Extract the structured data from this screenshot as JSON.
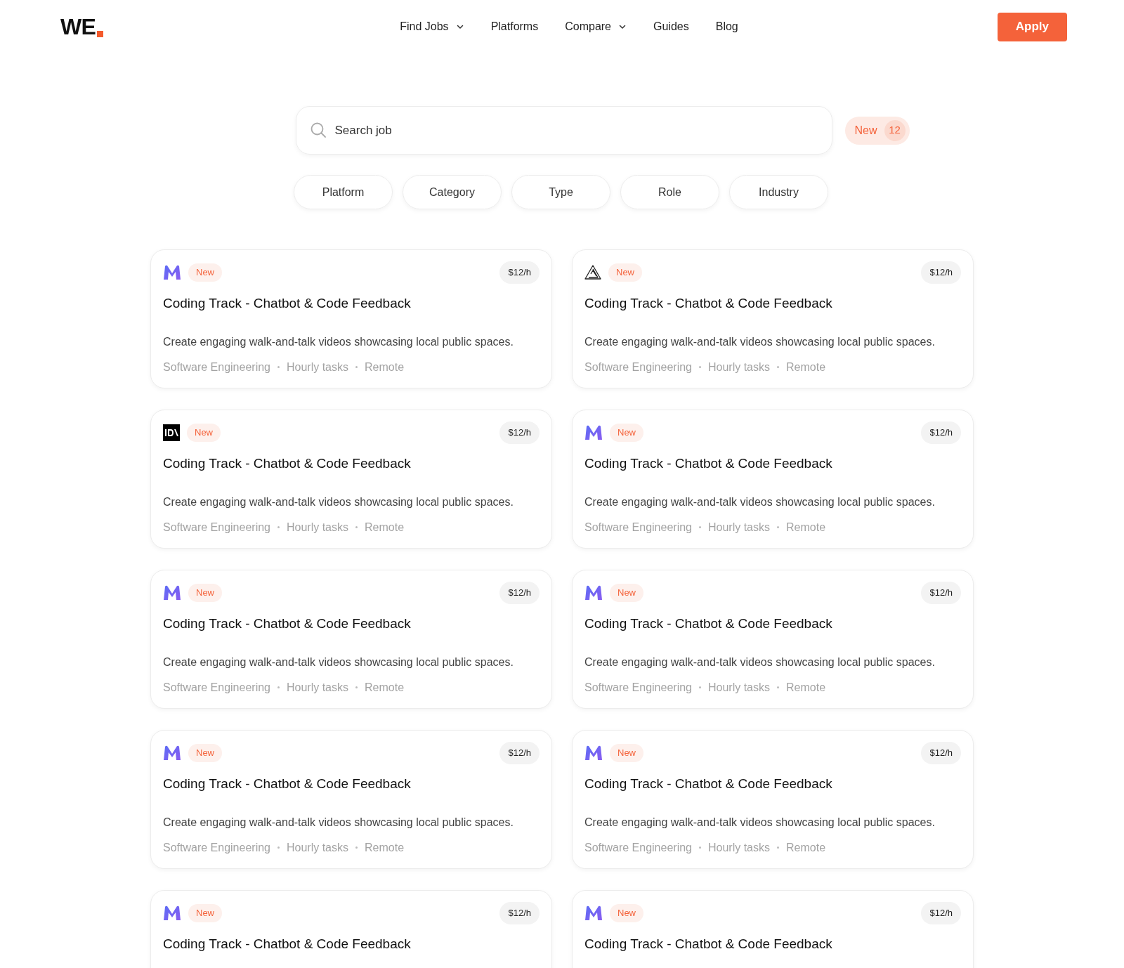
{
  "header": {
    "logo": "WE",
    "nav": [
      {
        "label": "Find Jobs",
        "dropdown": true
      },
      {
        "label": "Platforms",
        "dropdown": false
      },
      {
        "label": "Compare",
        "dropdown": true
      },
      {
        "label": "Guides",
        "dropdown": false
      },
      {
        "label": "Blog",
        "dropdown": false
      }
    ],
    "cta": "Apply"
  },
  "search": {
    "placeholder": "Search job",
    "new_label": "New",
    "new_count": "12"
  },
  "filters": [
    "Platform",
    "Category",
    "Type",
    "Role",
    "Industry"
  ],
  "jobs": [
    {
      "kind": "m",
      "badge": "New",
      "rate": "$12/h",
      "title": "Coding Track - Chatbot & Code Feedback",
      "description": "Create engaging walk-and-talk videos showcasing local public spaces.",
      "tags": [
        "Software Engineering",
        "Hourly tasks",
        "Remote"
      ]
    },
    {
      "kind": "triangle",
      "badge": "New",
      "rate": "$12/h",
      "title": "Coding Track - Chatbot & Code Feedback",
      "description": "Create engaging walk-and-talk videos showcasing local public spaces.",
      "tags": [
        "Software Engineering",
        "Hourly tasks",
        "Remote"
      ]
    },
    {
      "kind": "dv",
      "badge": "New",
      "rate": "$12/h",
      "title": "Coding Track - Chatbot & Code Feedback",
      "description": "Create engaging walk-and-talk videos showcasing local public spaces.",
      "tags": [
        "Software Engineering",
        "Hourly tasks",
        "Remote"
      ]
    },
    {
      "kind": "m",
      "badge": "New",
      "rate": "$12/h",
      "title": "Coding Track - Chatbot & Code Feedback",
      "description": "Create engaging walk-and-talk videos showcasing local public spaces.",
      "tags": [
        "Software Engineering",
        "Hourly tasks",
        "Remote"
      ]
    },
    {
      "kind": "m",
      "badge": "New",
      "rate": "$12/h",
      "title": "Coding Track - Chatbot & Code Feedback",
      "description": "Create engaging walk-and-talk videos showcasing local public spaces.",
      "tags": [
        "Software Engineering",
        "Hourly tasks",
        "Remote"
      ]
    },
    {
      "kind": "m",
      "badge": "New",
      "rate": "$12/h",
      "title": "Coding Track - Chatbot & Code Feedback",
      "description": "Create engaging walk-and-talk videos showcasing local public spaces.",
      "tags": [
        "Software Engineering",
        "Hourly tasks",
        "Remote"
      ]
    },
    {
      "kind": "m",
      "badge": "New",
      "rate": "$12/h",
      "title": "Coding Track - Chatbot & Code Feedback",
      "description": "Create engaging walk-and-talk videos showcasing local public spaces.",
      "tags": [
        "Software Engineering",
        "Hourly tasks",
        "Remote"
      ]
    },
    {
      "kind": "m",
      "badge": "New",
      "rate": "$12/h",
      "title": "Coding Track - Chatbot & Code Feedback",
      "description": "Create engaging walk-and-talk videos showcasing local public spaces.",
      "tags": [
        "Software Engineering",
        "Hourly tasks",
        "Remote"
      ]
    },
    {
      "kind": "m",
      "badge": "New",
      "rate": "$12/h",
      "title": "Coding Track - Chatbot & Code Feedback"
    },
    {
      "kind": "m",
      "badge": "New",
      "rate": "$12/h",
      "title": "Coding Track - Chatbot & Code Feedback"
    }
  ]
}
